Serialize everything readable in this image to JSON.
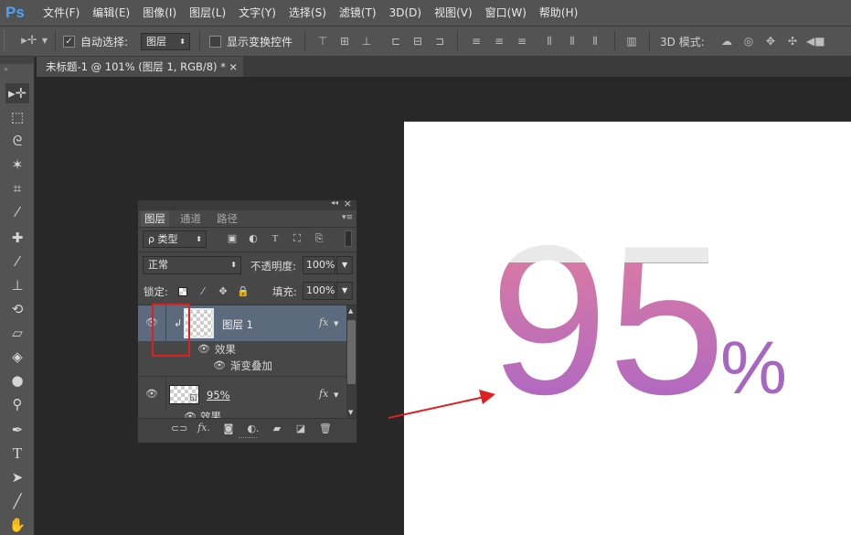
{
  "app": {
    "logo": "Ps"
  },
  "menu": [
    "文件(F)",
    "编辑(E)",
    "图像(I)",
    "图层(L)",
    "文字(Y)",
    "选择(S)",
    "滤镜(T)",
    "3D(D)",
    "视图(V)",
    "窗口(W)",
    "帮助(H)"
  ],
  "options": {
    "auto_select_label": "自动选择:",
    "auto_select_checked": true,
    "auto_select_value": "图层",
    "show_transform_label": "显示变换控件",
    "show_transform_checked": false,
    "mode_3d_label": "3D 模式:"
  },
  "document": {
    "tab_title": "未标题-1 @ 101% (图层 1, RGB/8) *",
    "close": "×"
  },
  "canvas": {
    "number": "95",
    "percent": "%",
    "gradient_top": "#e8809a",
    "gradient_bottom": "#a564c8"
  },
  "layers_panel": {
    "collapse": "◂◂",
    "close": "×",
    "menu": "▾≡",
    "tabs": [
      "图层",
      "通道",
      "路径"
    ],
    "filter_kind": "ρ 类型",
    "blend_mode": "正常",
    "opacity_label": "不透明度:",
    "opacity_value": "100%",
    "lock_label": "锁定:",
    "fill_label": "填充:",
    "fill_value": "100%",
    "layers": [
      {
        "name": "图层 1",
        "selected": true,
        "clipped": true,
        "fx": "fx",
        "effects_label": "效果",
        "effects": [
          "渐变叠加"
        ]
      },
      {
        "name": "95%",
        "selected": false,
        "clipped": false,
        "fx": "fx",
        "effects_label": "效果",
        "effects": []
      }
    ]
  },
  "accent": "#e02020"
}
